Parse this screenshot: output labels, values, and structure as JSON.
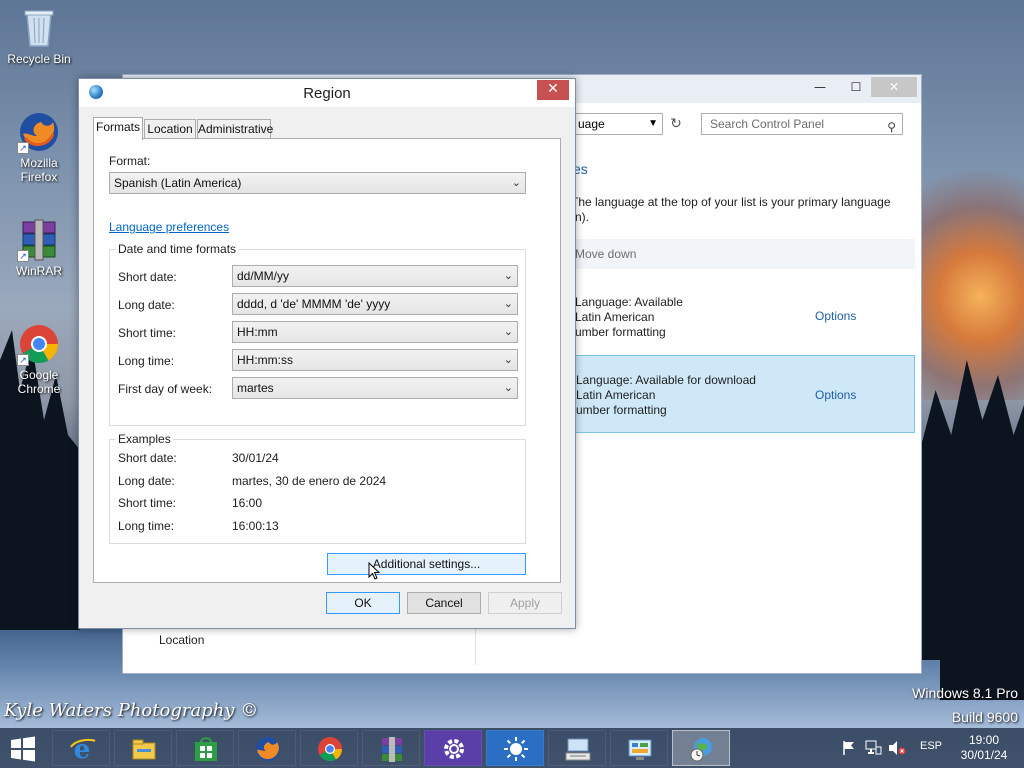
{
  "desktop": {
    "icons": [
      {
        "label_line1": "Recycle Bin",
        "label_line2": "",
        "icon": "recycle-bin-icon"
      },
      {
        "label_line1": "Mozilla",
        "label_line2": "Firefox",
        "icon": "firefox-icon"
      },
      {
        "label_line1": "WinRAR",
        "label_line2": "",
        "icon": "winrar-icon"
      },
      {
        "label_line1": "Google",
        "label_line2": "Chrome",
        "icon": "chrome-icon"
      }
    ],
    "watermark": "Kyle Waters Photography ©",
    "os_name": "Windows 8.1 Pro",
    "os_build": "Build 9600"
  },
  "control_panel": {
    "address_value": "uage",
    "search_placeholder": "Search Control Panel",
    "heading_fragment": "es",
    "description_line1": "The language at the top of your list is your primary language",
    "description_line2": "n).",
    "move_down": "Move down",
    "languages": [
      {
        "line1": "Language: Available",
        "line2": "Latin American",
        "line3": "umber formatting",
        "options": "Options",
        "selected": false
      },
      {
        "line1": "Language: Available for download",
        "line2": "Latin American",
        "line3": "umber formatting",
        "options": "Options",
        "selected": true
      }
    ],
    "location_label": "Location"
  },
  "region_dialog": {
    "title": "Region",
    "tabs": [
      "Formats",
      "Location",
      "Administrative"
    ],
    "active_tab": "Formats",
    "format_label": "Format:",
    "format_value": "Spanish (Latin America)",
    "language_preferences_link": "Language preferences",
    "date_time_group_title": "Date and time formats",
    "date_time_rows": [
      {
        "label": "Short date:",
        "value": "dd/MM/yy"
      },
      {
        "label": "Long date:",
        "value": "dddd, d 'de' MMMM 'de' yyyy"
      },
      {
        "label": "Short time:",
        "value": "HH:mm"
      },
      {
        "label": "Long time:",
        "value": "HH:mm:ss"
      },
      {
        "label": "First day of week:",
        "value": "martes"
      }
    ],
    "examples_group_title": "Examples",
    "examples": [
      {
        "label": "Short date:",
        "value": "30/01/24"
      },
      {
        "label": "Long date:",
        "value": "martes, 30 de enero de 2024"
      },
      {
        "label": "Short time:",
        "value": "16:00"
      },
      {
        "label": "Long time:",
        "value": "16:00:13"
      }
    ],
    "additional_settings": "Additional settings...",
    "ok": "OK",
    "cancel": "Cancel",
    "apply": "Apply"
  },
  "taskbar": {
    "apps": [
      "internet-explorer-icon",
      "file-explorer-icon",
      "store-icon",
      "firefox-icon",
      "chrome-icon",
      "winrar-icon",
      "settings-icon",
      "brightness-icon",
      "on-screen-keyboard-icon",
      "control-panel-icon",
      "region-icon"
    ],
    "language": "ESP",
    "time": "19:00",
    "date": "30/01/24"
  },
  "colors": {
    "link": "#0066cc",
    "selection": "#cfe8f7",
    "close_button": "#c75050",
    "taskbar": "#23324b"
  }
}
